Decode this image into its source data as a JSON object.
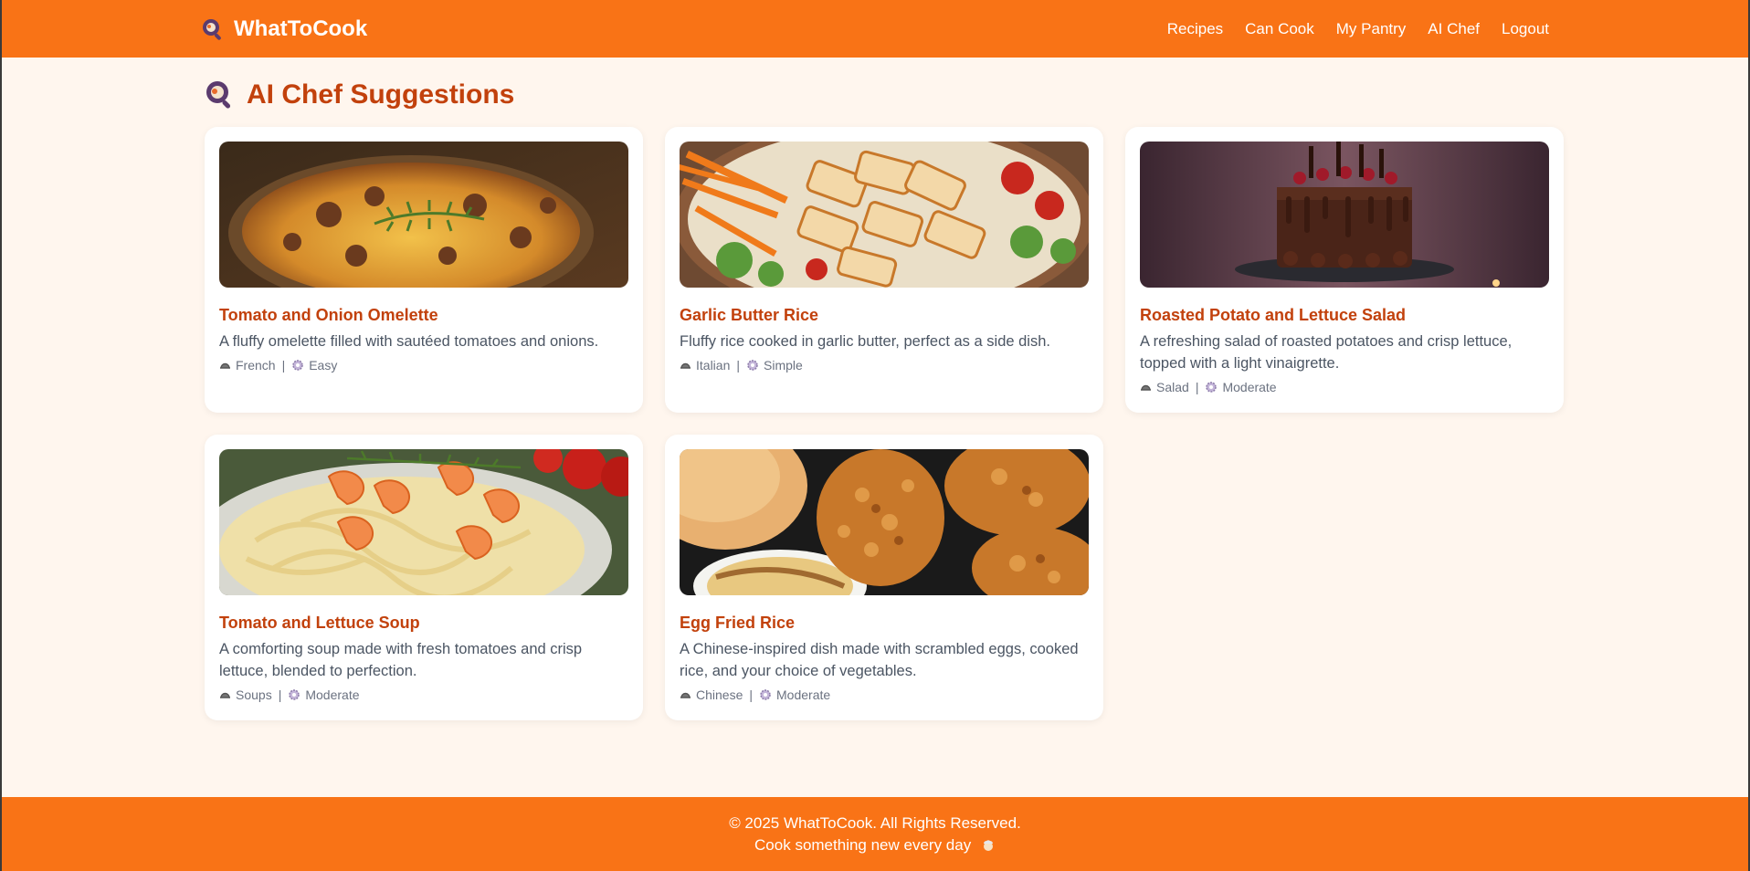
{
  "header": {
    "brand": "WhatToCook",
    "nav": [
      {
        "label": "Recipes"
      },
      {
        "label": "Can Cook"
      },
      {
        "label": "My Pantry"
      },
      {
        "label": "AI Chef"
      },
      {
        "label": "Logout"
      }
    ]
  },
  "page": {
    "title": "AI Chef Suggestions"
  },
  "recipes": [
    {
      "title": "Tomato and Onion Omelette",
      "description": "A fluffy omelette filled with sautéed tomatoes and onions.",
      "cuisine": "French",
      "difficulty": "Easy",
      "image": "shepherds-pie-image"
    },
    {
      "title": "Garlic Butter Rice",
      "description": "Fluffy rice cooked in garlic butter, perfect as a side dish.",
      "cuisine": "Italian",
      "difficulty": "Simple",
      "image": "chicken-salad-image"
    },
    {
      "title": "Roasted Potato and Lettuce Salad",
      "description": "A refreshing salad of roasted potatoes and crisp lettuce, topped with a light vinaigrette.",
      "cuisine": "Salad",
      "difficulty": "Moderate",
      "image": "chocolate-cake-image"
    },
    {
      "title": "Tomato and Lettuce Soup",
      "description": "A comforting soup made with fresh tomatoes and crisp lettuce, blended to perfection.",
      "cuisine": "Soups",
      "difficulty": "Moderate",
      "image": "shrimp-pasta-image"
    },
    {
      "title": "Egg Fried Rice",
      "description": "A Chinese-inspired dish made with scrambled eggs, cooked rice, and your choice of vegetables.",
      "cuisine": "Chinese",
      "difficulty": "Moderate",
      "image": "fried-chicken-image"
    }
  ],
  "footer": {
    "copyright": "© 2025 WhatToCook. All Rights Reserved.",
    "tagline": "Cook something new every day"
  },
  "colors": {
    "brand_orange": "#f97316",
    "title_orange": "#c2410c",
    "background": "#fff6ee"
  }
}
